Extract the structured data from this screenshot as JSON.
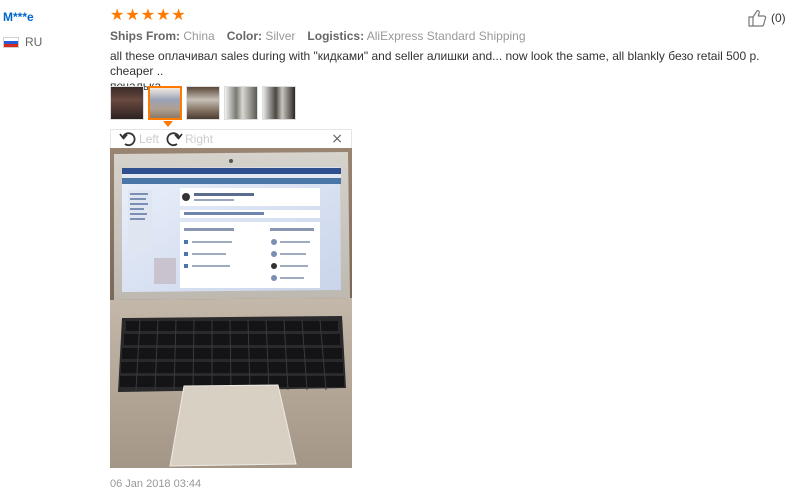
{
  "reviewer": {
    "name": "M***e",
    "country": "RU",
    "flag_colors": [
      "#ffffff",
      "#2a5bd7",
      "#d52b1e"
    ]
  },
  "review": {
    "rating": 5,
    "star_glyph": "★",
    "meta": [
      {
        "key": "Ships From:",
        "value": "China"
      },
      {
        "key": "Color:",
        "value": "Silver"
      },
      {
        "key": "Logistics:",
        "value": "AliExpress Standard Shipping"
      }
    ],
    "text_line1": "all these оплачивал sales during with \"кидками\" and seller алишки and... now look the same, all blankly безо retail 500 р. cheaper ..",
    "text_line2": "печалька.",
    "helpful_count": "(0)",
    "timestamp": "06 Jan 2018 03:44"
  },
  "viewer": {
    "rotate_left_label": "Left",
    "rotate_right_label": "Right",
    "close_glyph": "×",
    "selected_thumbnail_index": 1,
    "thumbnail_count": 5
  },
  "colors": {
    "star": "#ff7a00",
    "link": "#0066cc",
    "selected_border": "#ff7a00"
  }
}
